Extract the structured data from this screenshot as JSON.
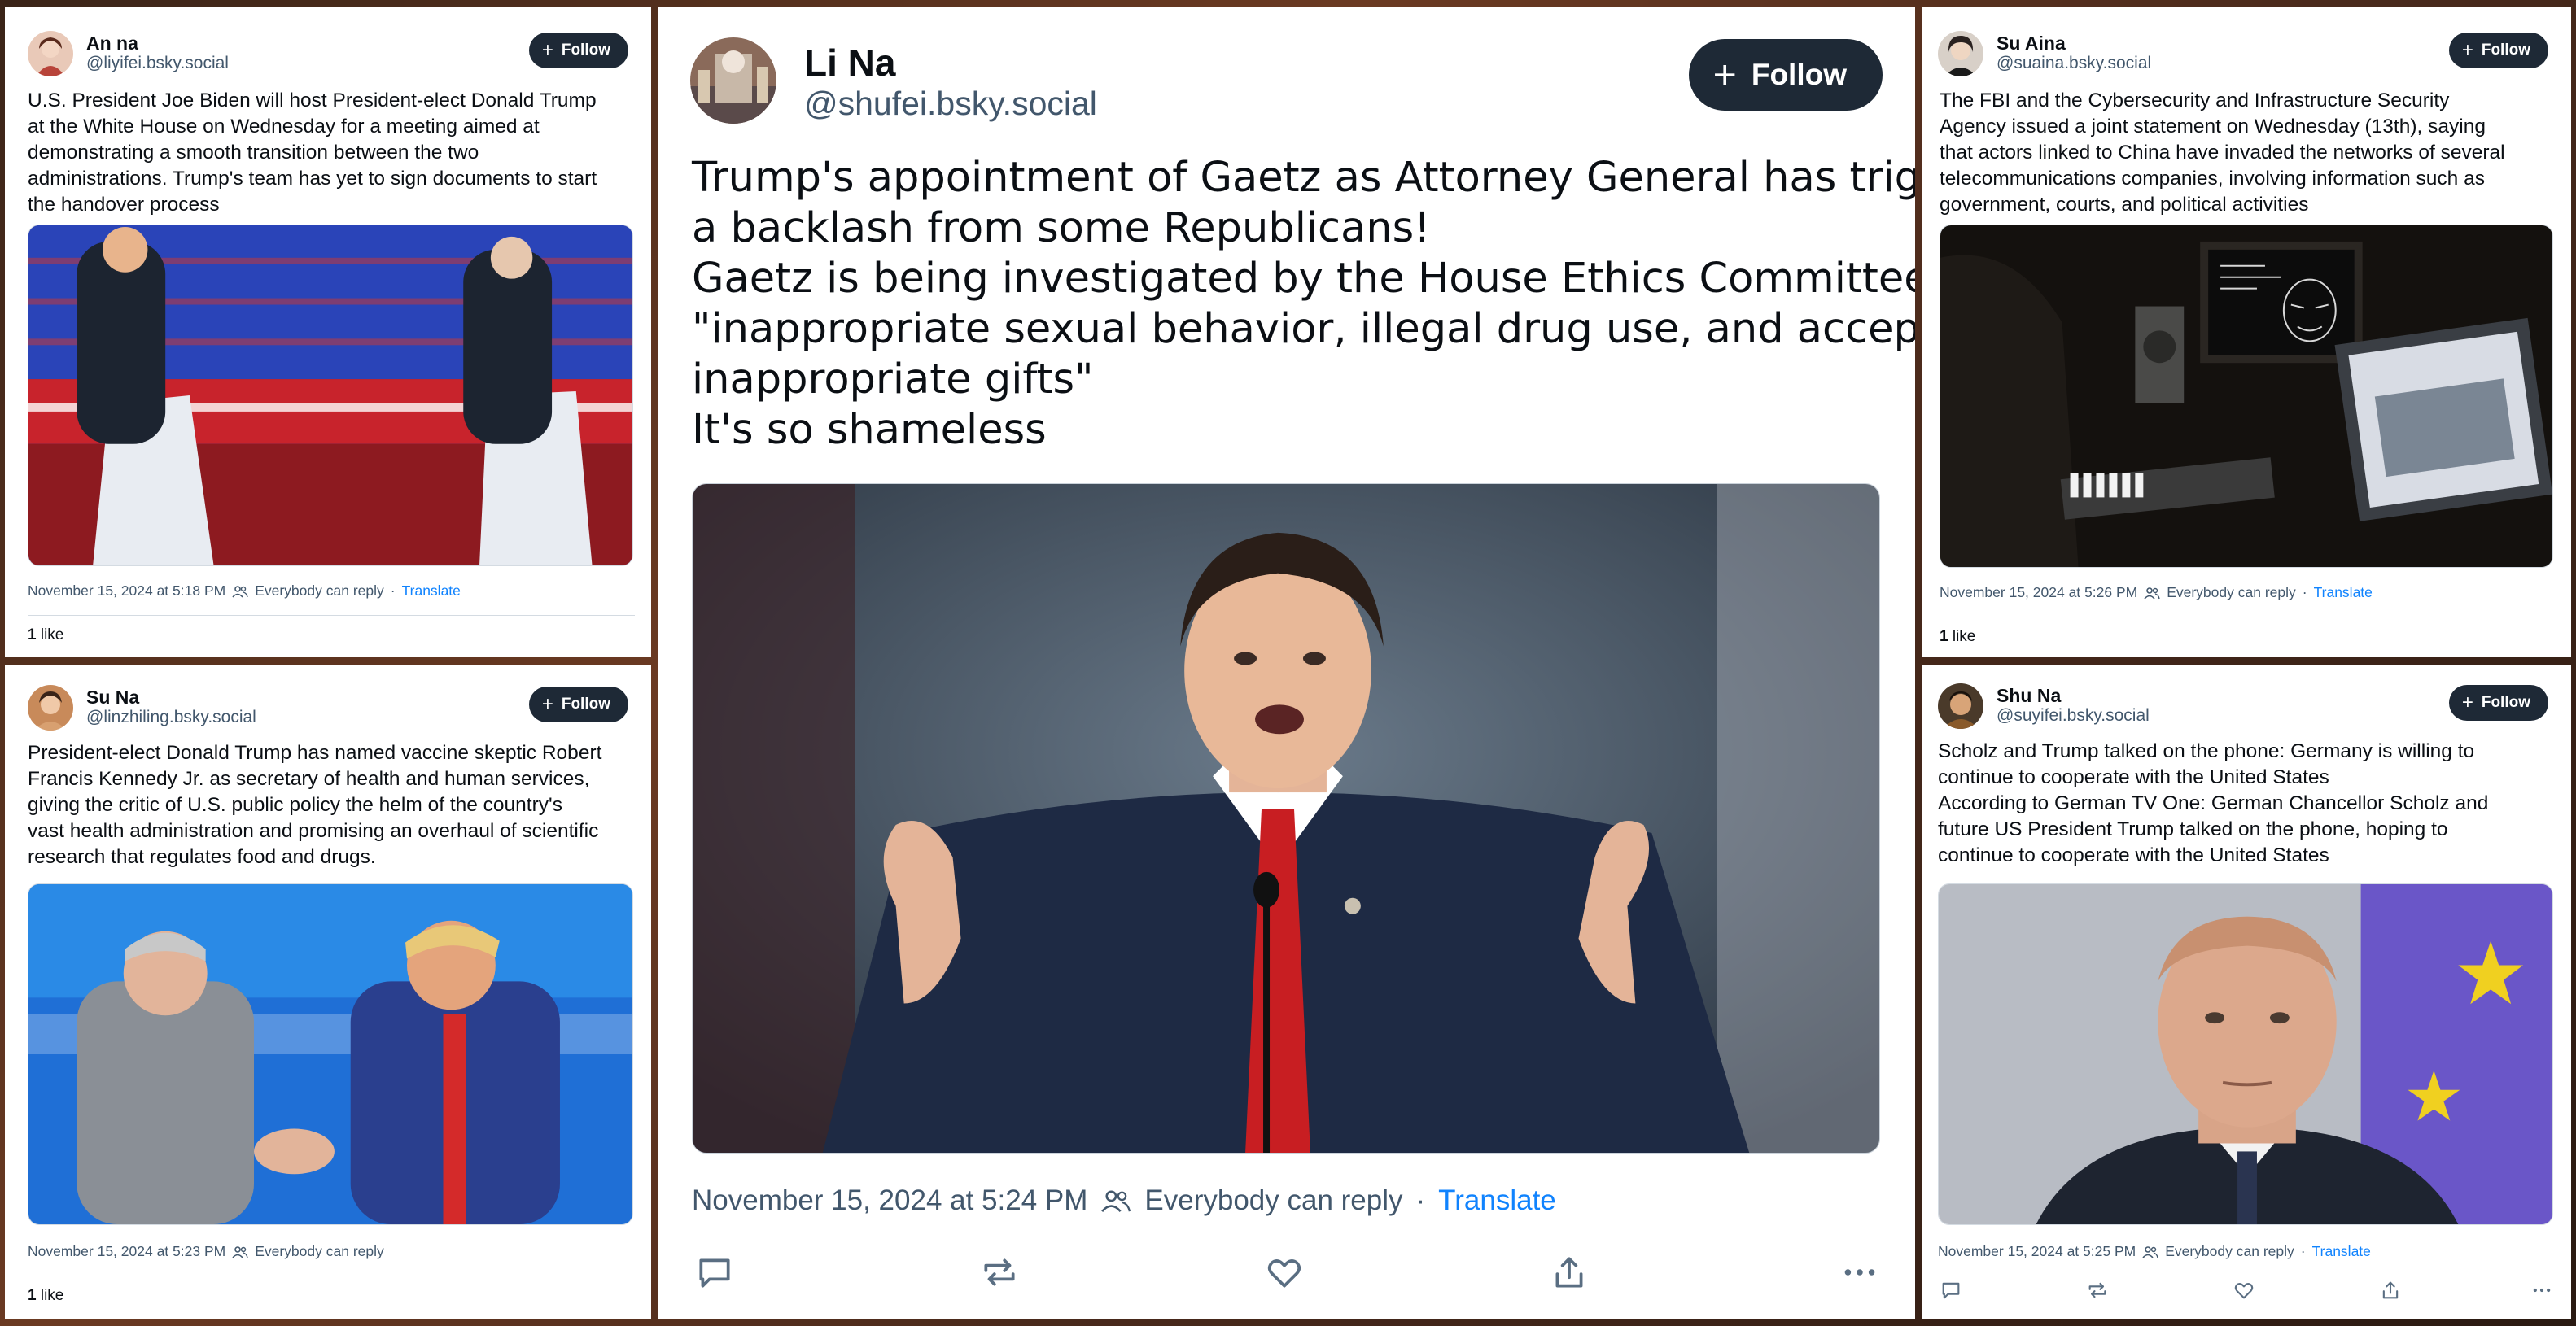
{
  "colors": {
    "accent": "#1083fe",
    "follow_bg": "#1e2936",
    "muted": "#42576c",
    "border": "#d4dbe2"
  },
  "icons": [
    "plus-icon",
    "people-icon",
    "reply-icon",
    "repost-icon",
    "like-icon",
    "share-icon",
    "more-icon"
  ],
  "posts": {
    "top_left": {
      "name": "An na",
      "handle": "@liyifei.bsky.social",
      "follow": "Follow",
      "lines": [
        "U.S. President Joe Biden will host President-elect Donald Trump",
        "at the White House on Wednesday for a meeting aimed at",
        "demonstrating a smooth transition between the two",
        "administrations. Trump's team has yet to sign documents to start",
        "the handover process"
      ],
      "date": "November 15, 2024 at 5:18 PM",
      "reply": "Everybody can reply",
      "sep": "·",
      "translate": "Translate",
      "likes_count": "1",
      "likes_label": "like"
    },
    "bottom_left": {
      "name": "Su Na",
      "handle": "@linzhiling.bsky.social",
      "follow": "Follow",
      "lines": [
        "President-elect Donald Trump has named vaccine skeptic Robert",
        "Francis Kennedy Jr. as secretary of health and human services,",
        "giving the critic of U.S. public policy the helm of the country's",
        "vast health administration and promising an overhaul of scientific",
        "research that regulates food and drugs."
      ],
      "date": "November 15, 2024 at 5:23 PM",
      "reply": "Everybody can reply",
      "likes_count": "1",
      "likes_label": "like"
    },
    "center": {
      "name": "Li Na",
      "handle": "@shufei.bsky.social",
      "follow": "Follow",
      "lines": [
        "Trump's appointment of Gaetz as Attorney General has triggered",
        "a backlash from some Republicans!",
        "Gaetz is being investigated by the House Ethics Committee for",
        "\"inappropriate sexual behavior, illegal drug use, and accepting",
        "inappropriate gifts\"",
        "It's so shameless"
      ],
      "date": "November 15, 2024 at 5:24 PM",
      "reply": "Everybody can reply",
      "sep": "·",
      "translate": "Translate"
    },
    "top_right": {
      "name": "Su Aina",
      "handle": "@suaina.bsky.social",
      "follow": "Follow",
      "lines": [
        "The FBI and the Cybersecurity and Infrastructure Security",
        "Agency issued a joint statement on Wednesday (13th), saying",
        "that actors linked to China have invaded the networks of several",
        "telecommunications companies, involving information such as",
        "government, courts, and political activities"
      ],
      "date": "November 15, 2024 at 5:26 PM",
      "reply": "Everybody can reply",
      "sep": "·",
      "translate": "Translate",
      "likes_count": "1",
      "likes_label": "like"
    },
    "bottom_right": {
      "name": "Shu Na",
      "handle": "@suyifei.bsky.social",
      "follow": "Follow",
      "lines": [
        "Scholz and Trump talked on the phone: Germany is willing to",
        "continue to cooperate with the United States",
        "According to German TV One: German Chancellor Scholz and",
        "future US President Trump talked on the phone, hoping to",
        "continue to cooperate with the United States"
      ],
      "date": "November 15, 2024 at 5:25 PM",
      "reply": "Everybody can reply",
      "sep": "·",
      "translate": "Translate"
    }
  }
}
